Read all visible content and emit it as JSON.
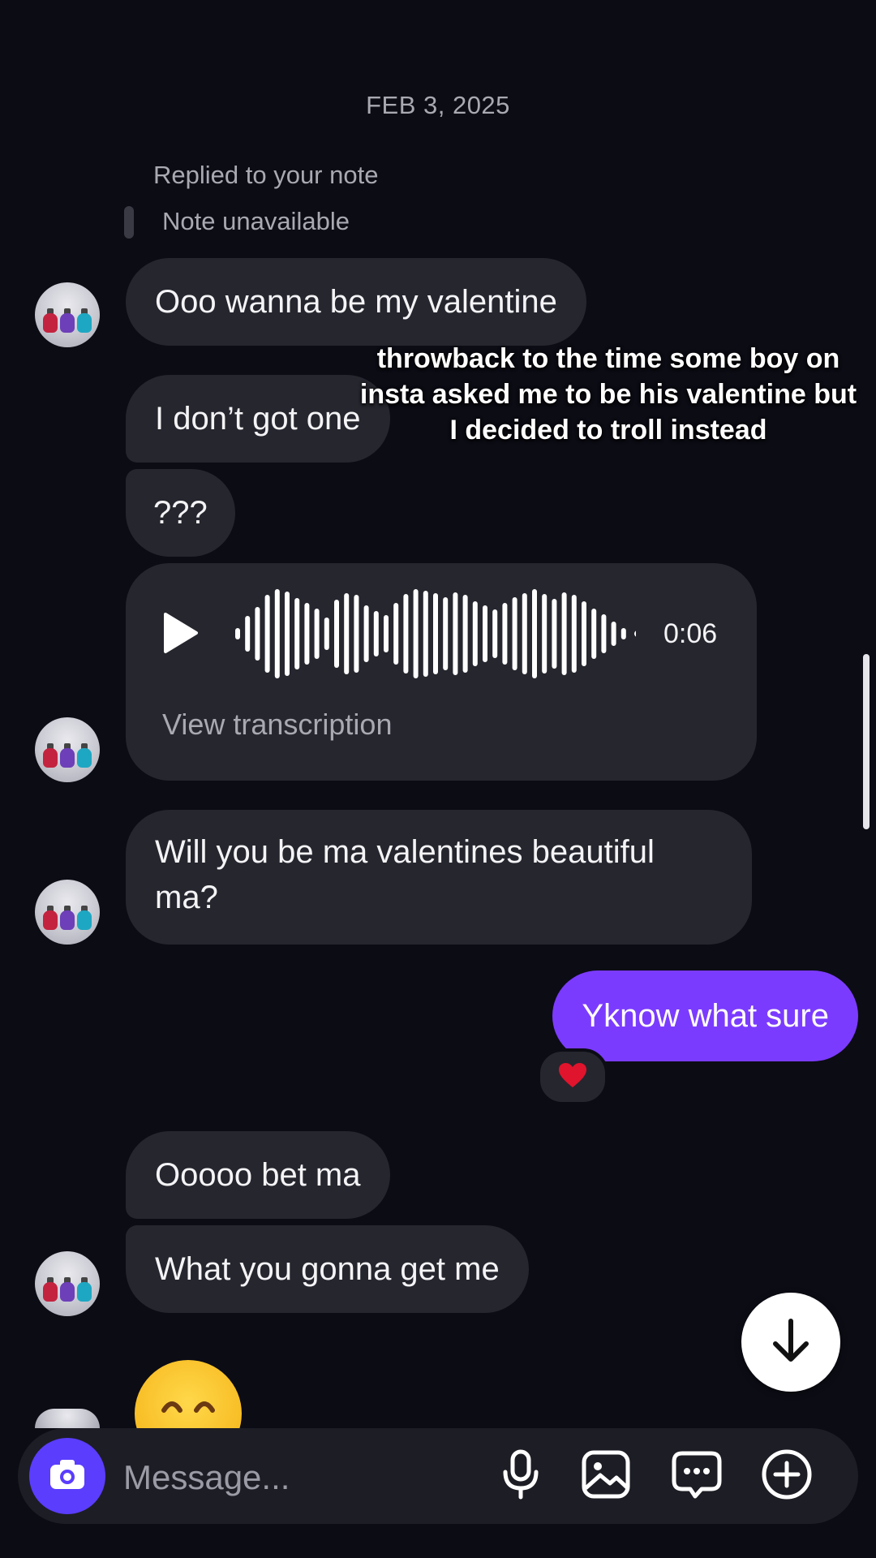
{
  "thread": {
    "date_divider": "FEB 3, 2025",
    "reply_context": {
      "label": "Replied to your note",
      "note": "Note unavailable"
    }
  },
  "messages": {
    "m1": "Ooo wanna be my valentine",
    "m2": "I don’t got one",
    "m3": "???",
    "voice": {
      "duration": "0:06",
      "transcription_link": "View transcription"
    },
    "m5": "Will you be ma valentines beautiful ma?",
    "mine": "Yknow what sure",
    "mine_reaction": "❤️",
    "m6": "Ooooo bet ma",
    "m7": "What you gonna get me"
  },
  "overlay_caption": "throwback to the time some boy on insta asked me to be his valentine but I decided to troll instead",
  "composer": {
    "placeholder": "Message...",
    "icons": [
      "camera-icon",
      "microphone-icon",
      "image-icon",
      "sticker-icon",
      "plus-icon"
    ]
  },
  "colors": {
    "background": "#0c0c15",
    "incoming_bubble": "#26262f",
    "outgoing_bubble": "#7b3bff",
    "camera_button": "#5a3dfd"
  }
}
